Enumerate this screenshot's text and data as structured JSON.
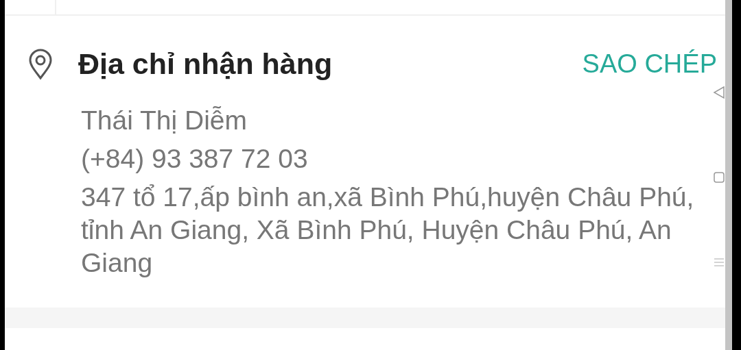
{
  "address_card": {
    "title": "Địa chỉ nhận hàng",
    "copy_button": "SAO CHÉP",
    "name": "Thái Thị Diễm",
    "phone": "(+84) 93 387 72 03",
    "address": "347 tổ 17,ấp bình an,xã Bình Phú,huyện Châu Phú, tỉnh An Giang, Xã Bình Phú, Huyện Châu Phú, An Giang"
  }
}
